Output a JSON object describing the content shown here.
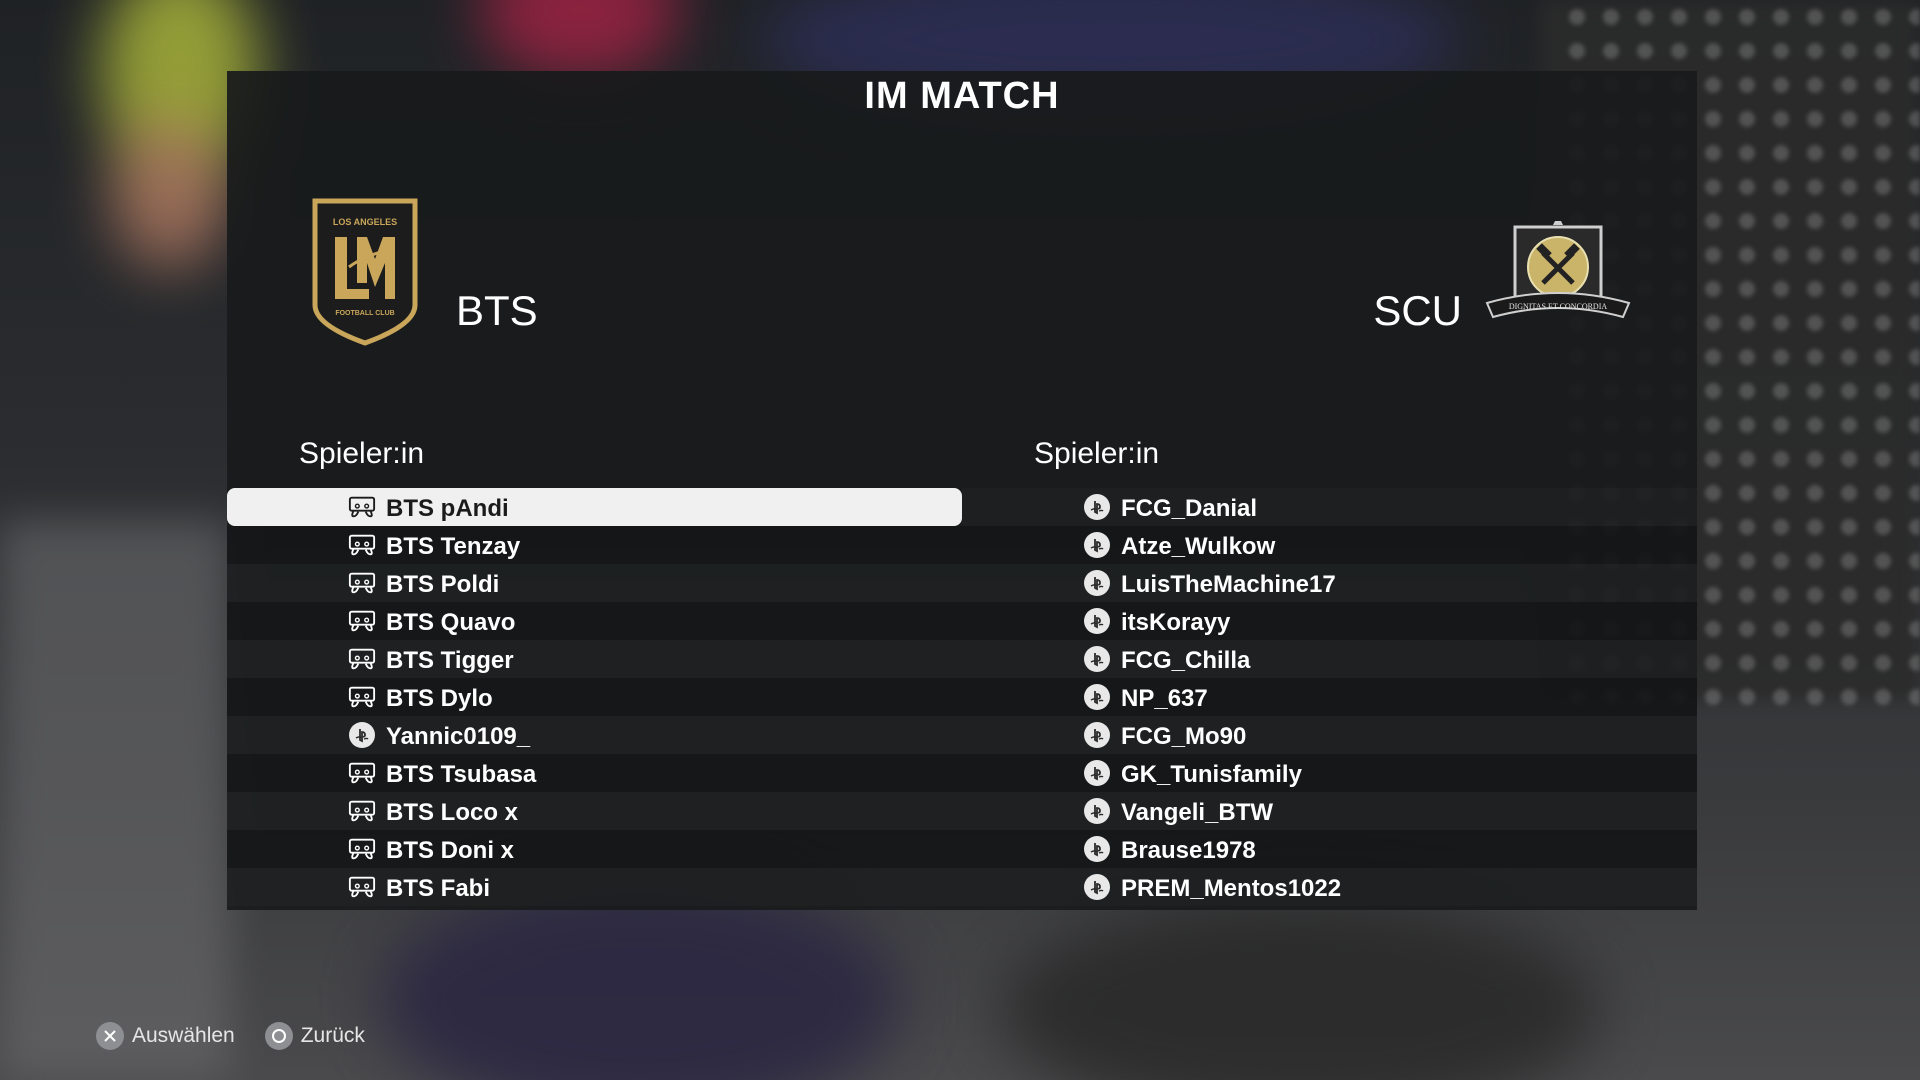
{
  "screen": {
    "title": "IM MATCH"
  },
  "teams": {
    "left": {
      "name": "BTS",
      "crest": {
        "icon": "lafc-crest-icon",
        "line1": "LOS ANGELES",
        "line2": "FOOTBALL CLUB",
        "primary": "#c9a65a",
        "bg": "#1c1c1c"
      }
    },
    "right": {
      "name": "SCU",
      "crest": {
        "icon": "hammer-crest-icon",
        "motto": "DIGNITAS ET CONCORDIA",
        "primary": "#c9b46a",
        "bg": "#222"
      }
    }
  },
  "columns": {
    "left_header": "Spieler:in",
    "right_header": "Spieler:in"
  },
  "players_left": [
    {
      "name": "BTS pAndi",
      "icon": "controller-icon",
      "selected": true
    },
    {
      "name": "BTS Tenzay",
      "icon": "controller-icon"
    },
    {
      "name": "BTS Poldi",
      "icon": "controller-icon"
    },
    {
      "name": "BTS Quavo",
      "icon": "controller-icon"
    },
    {
      "name": "BTS Tigger",
      "icon": "controller-icon"
    },
    {
      "name": "BTS Dylo",
      "icon": "controller-icon"
    },
    {
      "name": "Yannic0109_",
      "icon": "playstation-icon"
    },
    {
      "name": "BTS Tsubasa",
      "icon": "controller-icon"
    },
    {
      "name": "BTS Loco x",
      "icon": "controller-icon"
    },
    {
      "name": "BTS Doni x",
      "icon": "controller-icon"
    },
    {
      "name": "BTS Fabi",
      "icon": "controller-icon"
    }
  ],
  "players_right": [
    {
      "name": "FCG_Danial",
      "icon": "playstation-icon"
    },
    {
      "name": "Atze_Wulkow",
      "icon": "playstation-icon"
    },
    {
      "name": "LuisTheMachine17",
      "icon": "playstation-icon"
    },
    {
      "name": "itsKorayy",
      "icon": "playstation-icon"
    },
    {
      "name": "FCG_Chilla",
      "icon": "playstation-icon"
    },
    {
      "name": "NP_637",
      "icon": "playstation-icon"
    },
    {
      "name": "FCG_Mo90",
      "icon": "playstation-icon"
    },
    {
      "name": "GK_Tunisfamily",
      "icon": "playstation-icon"
    },
    {
      "name": "Vangeli_BTW",
      "icon": "playstation-icon"
    },
    {
      "name": "Brause1978",
      "icon": "playstation-icon"
    },
    {
      "name": "PREM_Mentos1022",
      "icon": "playstation-icon"
    }
  ],
  "footer": {
    "select": {
      "label": "Auswählen",
      "icon": "cross-button-icon"
    },
    "back": {
      "label": "Zurück",
      "icon": "circle-button-icon"
    }
  },
  "colors": {
    "panel": "#181a1b",
    "selected_row": "#f0f0f0",
    "text": "#ffffff"
  }
}
